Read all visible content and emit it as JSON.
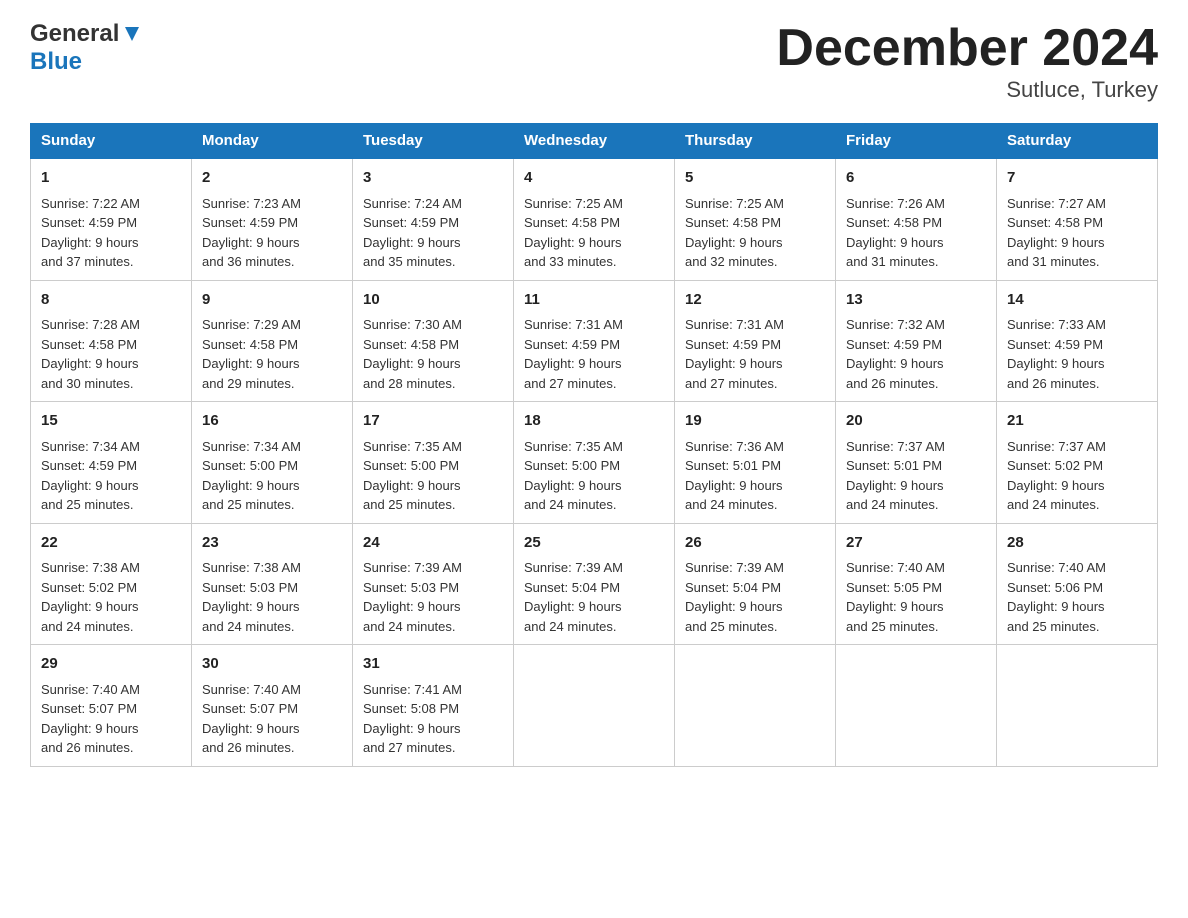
{
  "header": {
    "logo_line1": "General",
    "logo_line2": "Blue",
    "month_title": "December 2024",
    "location": "Sutluce, Turkey"
  },
  "weekdays": [
    "Sunday",
    "Monday",
    "Tuesday",
    "Wednesday",
    "Thursday",
    "Friday",
    "Saturday"
  ],
  "weeks": [
    [
      {
        "day": "1",
        "sunrise": "7:22 AM",
        "sunset": "4:59 PM",
        "daylight": "9 hours and 37 minutes."
      },
      {
        "day": "2",
        "sunrise": "7:23 AM",
        "sunset": "4:59 PM",
        "daylight": "9 hours and 36 minutes."
      },
      {
        "day": "3",
        "sunrise": "7:24 AM",
        "sunset": "4:59 PM",
        "daylight": "9 hours and 35 minutes."
      },
      {
        "day": "4",
        "sunrise": "7:25 AM",
        "sunset": "4:58 PM",
        "daylight": "9 hours and 33 minutes."
      },
      {
        "day": "5",
        "sunrise": "7:25 AM",
        "sunset": "4:58 PM",
        "daylight": "9 hours and 32 minutes."
      },
      {
        "day": "6",
        "sunrise": "7:26 AM",
        "sunset": "4:58 PM",
        "daylight": "9 hours and 31 minutes."
      },
      {
        "day": "7",
        "sunrise": "7:27 AM",
        "sunset": "4:58 PM",
        "daylight": "9 hours and 31 minutes."
      }
    ],
    [
      {
        "day": "8",
        "sunrise": "7:28 AM",
        "sunset": "4:58 PM",
        "daylight": "9 hours and 30 minutes."
      },
      {
        "day": "9",
        "sunrise": "7:29 AM",
        "sunset": "4:58 PM",
        "daylight": "9 hours and 29 minutes."
      },
      {
        "day": "10",
        "sunrise": "7:30 AM",
        "sunset": "4:58 PM",
        "daylight": "9 hours and 28 minutes."
      },
      {
        "day": "11",
        "sunrise": "7:31 AM",
        "sunset": "4:59 PM",
        "daylight": "9 hours and 27 minutes."
      },
      {
        "day": "12",
        "sunrise": "7:31 AM",
        "sunset": "4:59 PM",
        "daylight": "9 hours and 27 minutes."
      },
      {
        "day": "13",
        "sunrise": "7:32 AM",
        "sunset": "4:59 PM",
        "daylight": "9 hours and 26 minutes."
      },
      {
        "day": "14",
        "sunrise": "7:33 AM",
        "sunset": "4:59 PM",
        "daylight": "9 hours and 26 minutes."
      }
    ],
    [
      {
        "day": "15",
        "sunrise": "7:34 AM",
        "sunset": "4:59 PM",
        "daylight": "9 hours and 25 minutes."
      },
      {
        "day": "16",
        "sunrise": "7:34 AM",
        "sunset": "5:00 PM",
        "daylight": "9 hours and 25 minutes."
      },
      {
        "day": "17",
        "sunrise": "7:35 AM",
        "sunset": "5:00 PM",
        "daylight": "9 hours and 25 minutes."
      },
      {
        "day": "18",
        "sunrise": "7:35 AM",
        "sunset": "5:00 PM",
        "daylight": "9 hours and 24 minutes."
      },
      {
        "day": "19",
        "sunrise": "7:36 AM",
        "sunset": "5:01 PM",
        "daylight": "9 hours and 24 minutes."
      },
      {
        "day": "20",
        "sunrise": "7:37 AM",
        "sunset": "5:01 PM",
        "daylight": "9 hours and 24 minutes."
      },
      {
        "day": "21",
        "sunrise": "7:37 AM",
        "sunset": "5:02 PM",
        "daylight": "9 hours and 24 minutes."
      }
    ],
    [
      {
        "day": "22",
        "sunrise": "7:38 AM",
        "sunset": "5:02 PM",
        "daylight": "9 hours and 24 minutes."
      },
      {
        "day": "23",
        "sunrise": "7:38 AM",
        "sunset": "5:03 PM",
        "daylight": "9 hours and 24 minutes."
      },
      {
        "day": "24",
        "sunrise": "7:39 AM",
        "sunset": "5:03 PM",
        "daylight": "9 hours and 24 minutes."
      },
      {
        "day": "25",
        "sunrise": "7:39 AM",
        "sunset": "5:04 PM",
        "daylight": "9 hours and 24 minutes."
      },
      {
        "day": "26",
        "sunrise": "7:39 AM",
        "sunset": "5:04 PM",
        "daylight": "9 hours and 25 minutes."
      },
      {
        "day": "27",
        "sunrise": "7:40 AM",
        "sunset": "5:05 PM",
        "daylight": "9 hours and 25 minutes."
      },
      {
        "day": "28",
        "sunrise": "7:40 AM",
        "sunset": "5:06 PM",
        "daylight": "9 hours and 25 minutes."
      }
    ],
    [
      {
        "day": "29",
        "sunrise": "7:40 AM",
        "sunset": "5:07 PM",
        "daylight": "9 hours and 26 minutes."
      },
      {
        "day": "30",
        "sunrise": "7:40 AM",
        "sunset": "5:07 PM",
        "daylight": "9 hours and 26 minutes."
      },
      {
        "day": "31",
        "sunrise": "7:41 AM",
        "sunset": "5:08 PM",
        "daylight": "9 hours and 27 minutes."
      },
      null,
      null,
      null,
      null
    ]
  ],
  "labels": {
    "sunrise": "Sunrise:",
    "sunset": "Sunset:",
    "daylight": "Daylight:"
  }
}
